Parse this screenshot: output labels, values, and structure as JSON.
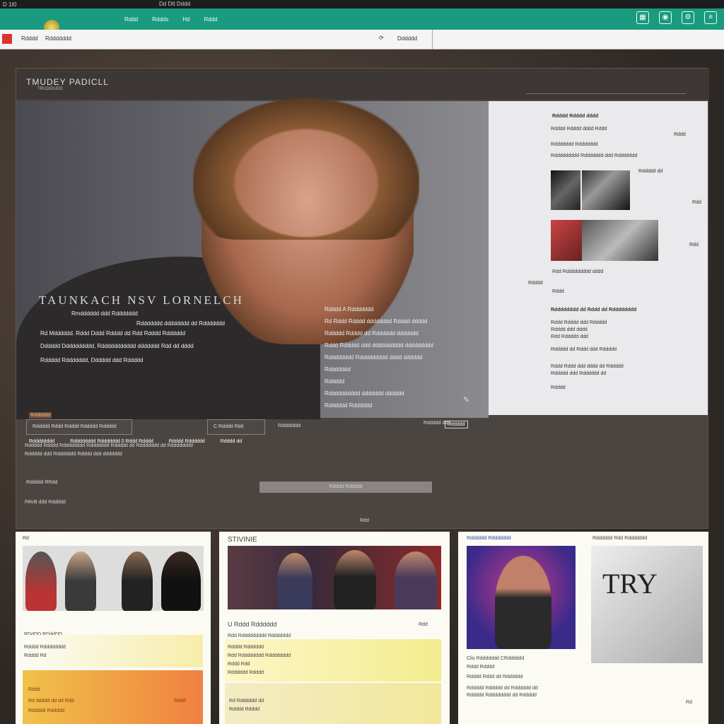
{
  "os_bar": {
    "left": "D 1ℓ0",
    "center": "Dd Dtt Dddd"
  },
  "top_nav": {
    "items": [
      "Rddd",
      "Rddds",
      "Hd",
      "Rddd"
    ]
  },
  "address_bar": {
    "left_a": "Rdddd",
    "left_b": "Rddddddd",
    "right_a": "⟳",
    "right_b": "Dddddd"
  },
  "panel": {
    "brand": "TMUDEY PADICLL",
    "brand_sub": "TRUDIDUDD",
    "hero": {
      "title": "TAUNKACH NSV LORNELCH",
      "lines": [
        "Rmdddddd ddd Rddddddd",
        "Rddddddd dddddddd dd Rddddddd",
        "Rd Mdddddd. Rddd Dddd Rdddd dd Rdd Rdddd Rdddddd",
        "Dddddd Dddddddddd, Rddddddddddd ddddddd Rdd dd dddd",
        "Rddddd Rddddddd, Dddddd ddd Rddddd"
      ],
      "badge": "Rdddddd",
      "mid_title": "Rdddd A Rddddddd",
      "mid_lines": [
        "Rd Rddd Rdddd dddddddd Rdddd ddddd",
        "Rddddd Rdddd dd Rdddddd ddddddd",
        "Rddd Rddddd ddd dddddddddd ddddddddd",
        "Rdddddddd Rddddddddd dddd dddddd",
        "Rddddddd",
        "Rddddd",
        "Rdddddddddd ddddddd dddddd",
        "Rdddddd Rdddddd"
      ],
      "mid_button": "Rddddd",
      "links": [
        "Rdddddddd",
        "Rdddddddd Rddddddd 0 Rddd Rdddd",
        "Rdddd Rdddddd",
        "Rdddd dd"
      ]
    },
    "sidebar": {
      "lines": [
        "Rdddd Rdddd dddd",
        "Rdddd Rdddd dddd Rddd",
        "Rddddddd Rddddddd",
        "Rddddddddd Rddddddd ddd Rddddddd",
        "Rddddd dd",
        "Rdd Rddddddddd dddd",
        "Rdddd",
        "Rddd",
        "Rdddddddd dd Rddd dd Rdddddddd",
        "Rddd Rdddd ddd Rddddd",
        "Rdddd ddd dddd",
        "Rdd Rddddd ddd",
        "Rddddd dd Rddd ddd Rddddd",
        "Rddd Rddd ddd dddd dd Rddddd",
        "Rddddd ddd Rdddddd dd",
        "Rdddd"
      ],
      "tags": [
        "Rddd",
        "Rdd",
        "Rdd"
      ]
    },
    "row2": {
      "pill_a": "Rddddd Rddd Rdddd Rddddd Rddddd",
      "pill_b": "C Rdddd Rdd",
      "pill_c": "Rddddddd",
      "right": "Rddddd ddd",
      "desc_a": "Rddddd Rdddd Rdddddddd Rddddddd Rddddd dd Rddddddd dd Rdddddddd",
      "desc_b": "Rddddd ddd Rddddddd Rdddd ddd ddddddd",
      "note_a": "Rddddd RRdd",
      "bar": "Rdddd Rddddd",
      "note_b": "PAVB ddd Rddddd",
      "marker": "Rdd"
    }
  },
  "cards": [
    {
      "top": "Rd",
      "title": "RDdDD RDddDD",
      "sub": "Rdddd Rdddddddd",
      "sub2": "Rdddd Rd",
      "grad_label": "Rddd",
      "grad_text": "Rd ddddd dd dd Rdd",
      "grad_right": "Rddd",
      "foot": "Rddddd Rddddd"
    },
    {
      "top": "STIVINIE",
      "title": "U Rddd Rdddddd",
      "lines": [
        "Rdd Rddddddddd Rddddddd",
        "Rdddd Rdddddd",
        "Rdd Rdddddddd Rdddddddd",
        "Rddd Rdd",
        "Rdddddd Rdddd"
      ],
      "right": "Rdd",
      "foot": "Rd Rdddddd dd",
      "foot2": "Rdddd Rdddd"
    },
    {
      "top": "Rdddddd Rddddddd",
      "top_right": "Rdddddd Rdd Rddddddd",
      "artwork": "TRY",
      "title": "Clis Rddddddd CRdddddd",
      "lines": [
        "Rddd Rdddd",
        "Rdddd Rddd dd Rdddddd",
        "Rddddd Rddddd dd Rdddddd dd",
        "Rddddd Rdddddddd dd Rddddd"
      ],
      "right": "Rd"
    }
  ]
}
